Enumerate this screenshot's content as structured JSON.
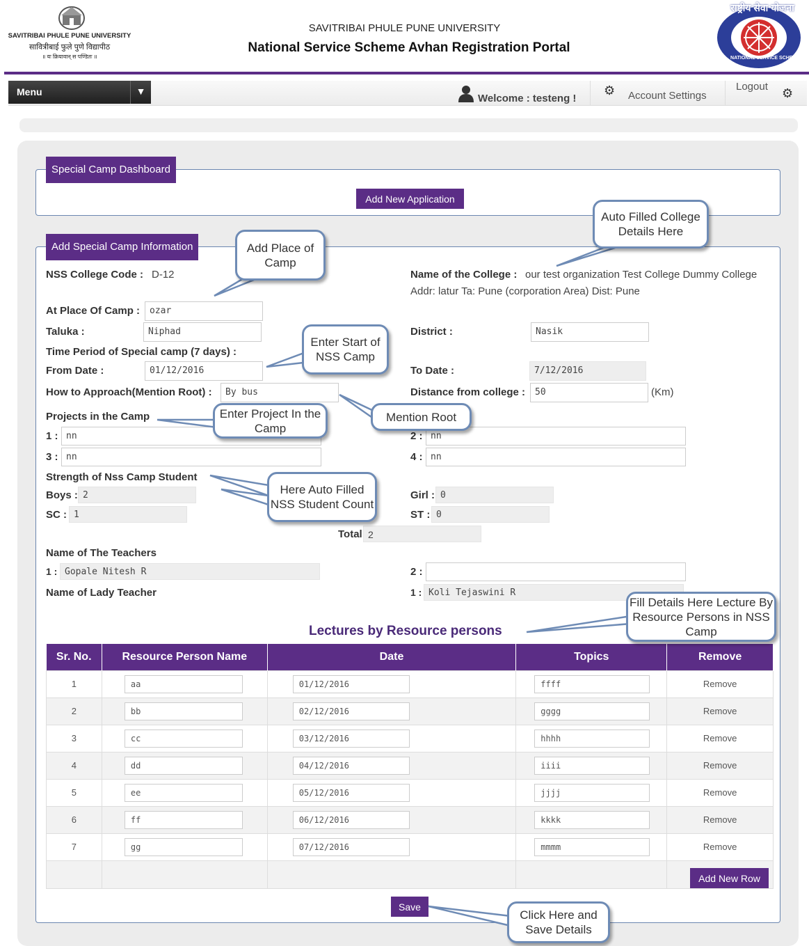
{
  "header": {
    "university_name_en": "SAVITRIBAI PHULE PUNE UNIVERSITY",
    "university_name_mr": "सावित्रीबाई फुले पुणे विद्यापीठ",
    "university_motto": "॥ यः क्रियावान् स पण्डितः ॥",
    "title_top": "SAVITRIBAI PHULE PUNE UNIVERSITY",
    "title_main": "National Service Scheme Avhan Registration Portal",
    "nss_logo_top": "राष्ट्रीय सेवा योजना",
    "nss_logo_bottom": "NATIONAL SERVICE SCHEME"
  },
  "navbar": {
    "menu_label": "Menu",
    "welcome_text": "Welcome : testeng !",
    "account_settings": "Account Settings",
    "logout": "Logout"
  },
  "dashboard": {
    "legend": "Special Camp Dashboard",
    "add_new_application": "Add New Application"
  },
  "camp_info": {
    "legend": "Add Special Camp Information",
    "college_code_label": "NSS College Code :",
    "college_code_value": "D-12",
    "college_name_label": "Name of the College :",
    "college_name_value": "our test organization Test College Dummy College",
    "college_address": "Addr: latur Ta: Pune (corporation Area) Dist: Pune",
    "place_label": "At Place Of Camp :",
    "place_value": "ozar",
    "taluka_label": "Taluka :",
    "taluka_value": "Niphad",
    "district_label": "District :",
    "district_value": "Nasik",
    "time_period_label": "Time Period of Special camp (7 days) :",
    "from_date_label": "From Date :",
    "from_date_value": "01/12/2016",
    "to_date_label": "To Date :",
    "to_date_value": "7/12/2016",
    "approach_label": "How to Approach(Mention Root) :",
    "approach_value": "By bus",
    "distance_label": "Distance from college :",
    "distance_value": "50",
    "distance_unit": "(Km)",
    "projects_label": "Projects in the Camp",
    "projects": [
      {
        "num": "1 :",
        "value": "nn"
      },
      {
        "num": "2 :",
        "value": "nn"
      },
      {
        "num": "3 :",
        "value": "nn"
      },
      {
        "num": "4 :",
        "value": "nn"
      }
    ],
    "strength_label": "Strength of Nss Camp Student",
    "boys_label": "Boys :",
    "boys_value": "2",
    "girl_label": "Girl :",
    "girl_value": "0",
    "sc_label": "SC :",
    "sc_value": "1",
    "st_label": "ST :",
    "st_value": "0",
    "total_label": "Total:",
    "total_value": "2",
    "teachers_label": "Name of The Teachers",
    "teacher1_num": "1 :",
    "teacher1_value": "Gopale Nitesh R",
    "teacher2_num": "2 :",
    "teacher2_value": "",
    "lady_teacher_label": "Name of Lady Teacher",
    "lady_teacher_num": "1 :",
    "lady_teacher_value": "Koli Tejaswini R"
  },
  "lectures": {
    "heading": "Lectures by Resource persons",
    "columns": [
      "Sr. No.",
      "Resource Person Name",
      "Date",
      "Topics",
      "Remove"
    ],
    "rows": [
      {
        "sr": "1",
        "name": "aa",
        "date": "01/12/2016",
        "topic": "ffff",
        "remove": "Remove"
      },
      {
        "sr": "2",
        "name": "bb",
        "date": "02/12/2016",
        "topic": "gggg",
        "remove": "Remove"
      },
      {
        "sr": "3",
        "name": "cc",
        "date": "03/12/2016",
        "topic": "hhhh",
        "remove": "Remove"
      },
      {
        "sr": "4",
        "name": "dd",
        "date": "04/12/2016",
        "topic": "iiii",
        "remove": "Remove"
      },
      {
        "sr": "5",
        "name": "ee",
        "date": "05/12/2016",
        "topic": "jjjj",
        "remove": "Remove"
      },
      {
        "sr": "6",
        "name": "ff",
        "date": "06/12/2016",
        "topic": "kkkk",
        "remove": "Remove"
      },
      {
        "sr": "7",
        "name": "gg",
        "date": "07/12/2016",
        "topic": "mmmm",
        "remove": "Remove"
      }
    ],
    "add_new_row": "Add New Row",
    "save": "Save"
  },
  "callouts": {
    "auto_filled_college": "Auto Filled College Details Here",
    "add_place": "Add Place of Camp",
    "enter_start": "Enter Start of NSS Camp",
    "enter_project": "Enter Project In the Camp",
    "mention_root": "Mention Root",
    "auto_filled_count": "Here Auto Filled NSS Student Count",
    "fill_details": "Fill Details Here Lecture By Resource Persons in NSS Camp",
    "click_save": "Click Here and Save Details"
  },
  "colors": {
    "brand_purple": "#5b2d86",
    "callout_border": "#6e8bb5",
    "nss_red": "#d32f2f",
    "nss_blue": "#2c3e99"
  }
}
